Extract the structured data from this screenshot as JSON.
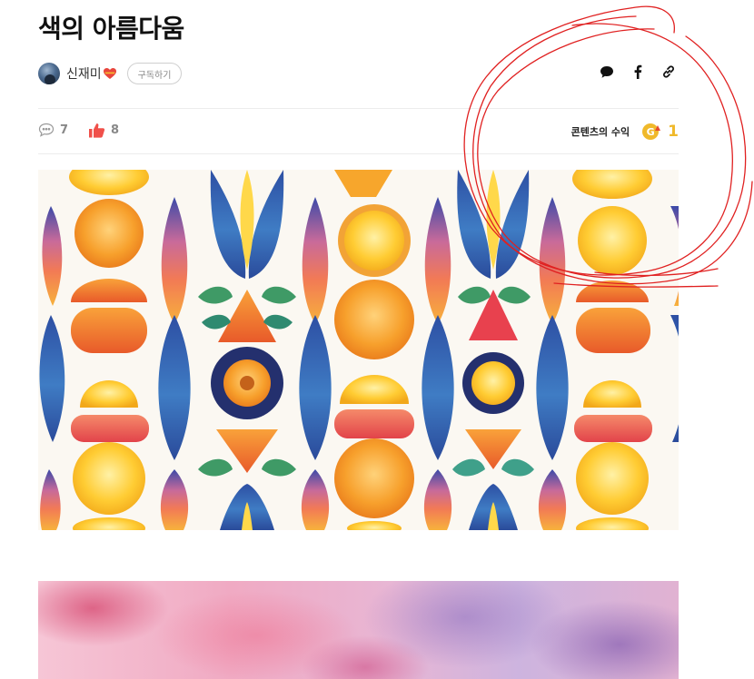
{
  "article": {
    "title": "색의 아름다움"
  },
  "author": {
    "name": "신재미",
    "subscribe_label": "구독하기"
  },
  "share": {
    "icons": [
      "comment-bubble-icon",
      "facebook-icon",
      "link-icon"
    ]
  },
  "stats": {
    "comments_count": "7",
    "likes_count": "8"
  },
  "revenue": {
    "label": "콘텐츠의 수익",
    "icon_letter": "G",
    "count": "1"
  },
  "colors": {
    "accent_gold": "#f0b92a",
    "like_red": "#f0504a",
    "annotation_red": "#e02020"
  }
}
